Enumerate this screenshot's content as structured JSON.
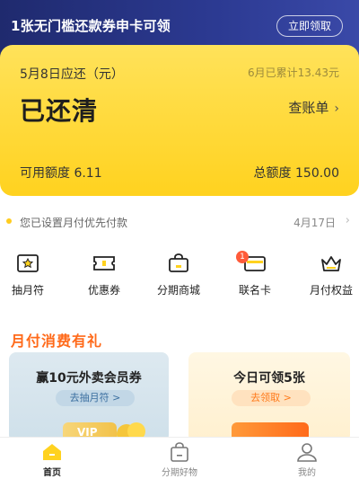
{
  "promo": {
    "text": "1张无门槛还款券申卡可领",
    "button": "立即领取"
  },
  "bill_card": {
    "due_label": "5月8日应还（元）",
    "cumulative": "6月已累计13.43元",
    "status": "已还清",
    "bill_link": "查账单",
    "available_label": "可用额度",
    "available_value": "6.11",
    "total_label": "总额度",
    "total_value": "150.00"
  },
  "notice": {
    "text": "您已设置月付优先付款",
    "date": "4月17日"
  },
  "shortcuts": [
    {
      "label": "抽月符",
      "icon": "lottery-icon"
    },
    {
      "label": "优惠券",
      "icon": "ticket-icon"
    },
    {
      "label": "分期商城",
      "icon": "shopping-bag-icon"
    },
    {
      "label": "联名卡",
      "icon": "card-icon",
      "badge": "1"
    },
    {
      "label": "月付权益",
      "icon": "crown-icon"
    }
  ],
  "section": {
    "title": "月付消费有礼"
  },
  "features": [
    {
      "title": "赢10元外卖会员券",
      "button": "去抽月符 >",
      "vip": "VIP"
    },
    {
      "title": "今日可领5张",
      "button": "去领取 >"
    }
  ],
  "tabbar": [
    {
      "label": "首页",
      "icon": "home-icon",
      "active": true
    },
    {
      "label": "分期好物",
      "icon": "bag-icon",
      "active": false
    },
    {
      "label": "我的",
      "icon": "profile-icon",
      "active": false
    }
  ],
  "colors": {
    "accent_yellow": "#ffd21f",
    "promo_blue": "#2c3a92",
    "section_orange": "#ff6a1a",
    "badge_red": "#ff5b3a"
  }
}
